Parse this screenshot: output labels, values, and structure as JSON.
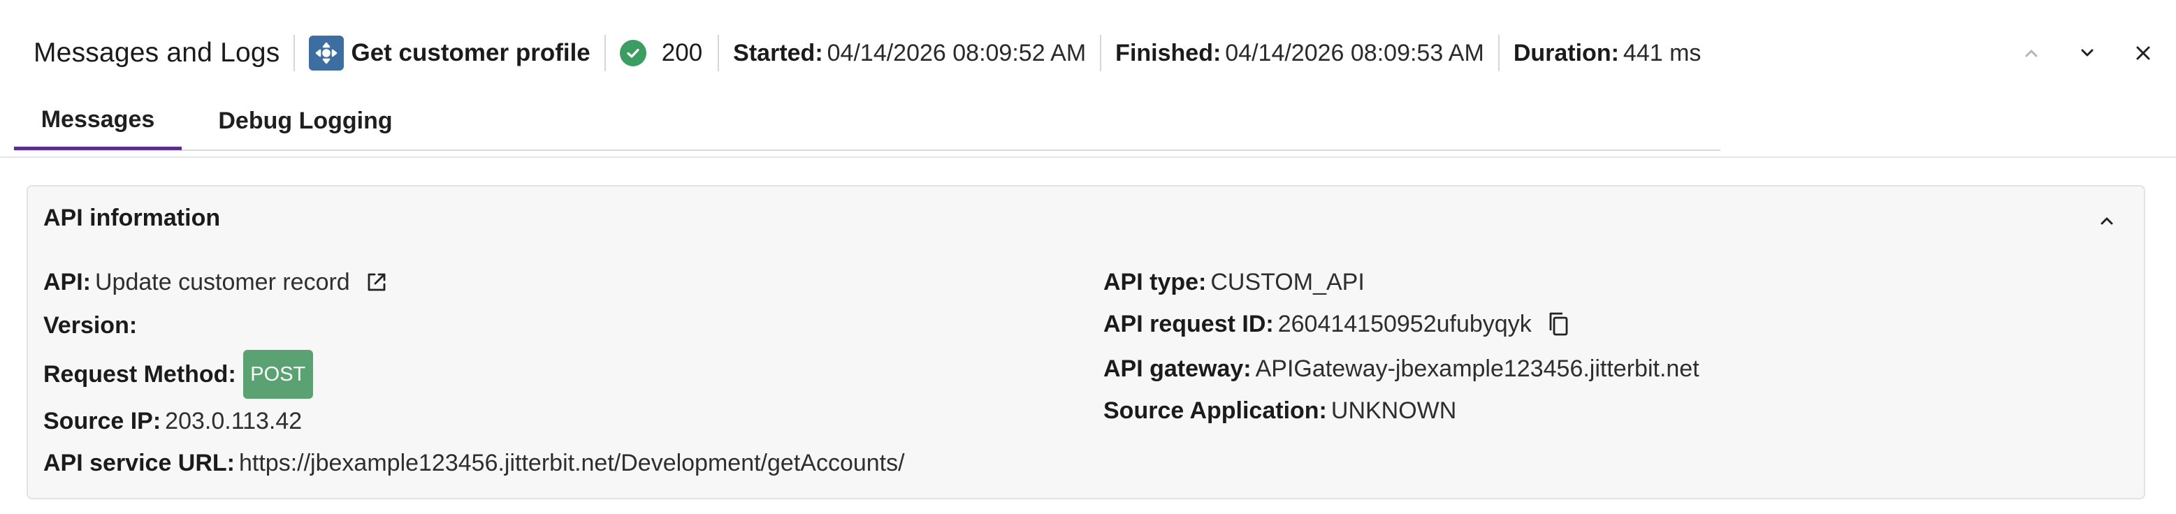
{
  "header": {
    "title": "Messages and Logs",
    "operation_name": "Get customer profile",
    "operation_icon": "operation-icon",
    "status_icon": "success-check-icon",
    "status_code": "200",
    "started_label": "Started:",
    "started_value": "04/14/2026 08:09:52 AM",
    "finished_label": "Finished:",
    "finished_value": "04/14/2026 08:09:53 AM",
    "duration_label": "Duration:",
    "duration_value": "441 ms",
    "controls": [
      "chevron-up-icon",
      "chevron-down-icon",
      "close-icon"
    ]
  },
  "tabs": [
    {
      "label": "Messages",
      "active": true
    },
    {
      "label": "Debug Logging",
      "active": false
    }
  ],
  "panel": {
    "title": "API information",
    "left": {
      "api_label": "API:",
      "api_value": "Update customer record",
      "version_label": "Version:",
      "version_value": "",
      "method_label": "Request Method:",
      "method_value": "POST",
      "source_ip_label": "Source IP:",
      "source_ip_value": "203.0.113.42",
      "service_url_label": "API service URL:",
      "service_url_value": "https://jbexample123456.jitterbit.net/Development/getAccounts/"
    },
    "right": {
      "api_type_label": "API type:",
      "api_type_value": "CUSTOM_API",
      "request_id_label": "API request ID:",
      "request_id_value": "260414150952ufubyqyk",
      "gateway_label": "API gateway:",
      "gateway_value": "APIGateway-jbexample123456.jitterbit.net",
      "source_app_label": "Source Application:",
      "source_app_value": "UNKNOWN"
    }
  },
  "colors": {
    "accent_tab": "#5b2d8e",
    "post_badge": "#5aa272",
    "status_ok": "#3c9d63",
    "operation_icon_bg": "#3d6ea1"
  }
}
